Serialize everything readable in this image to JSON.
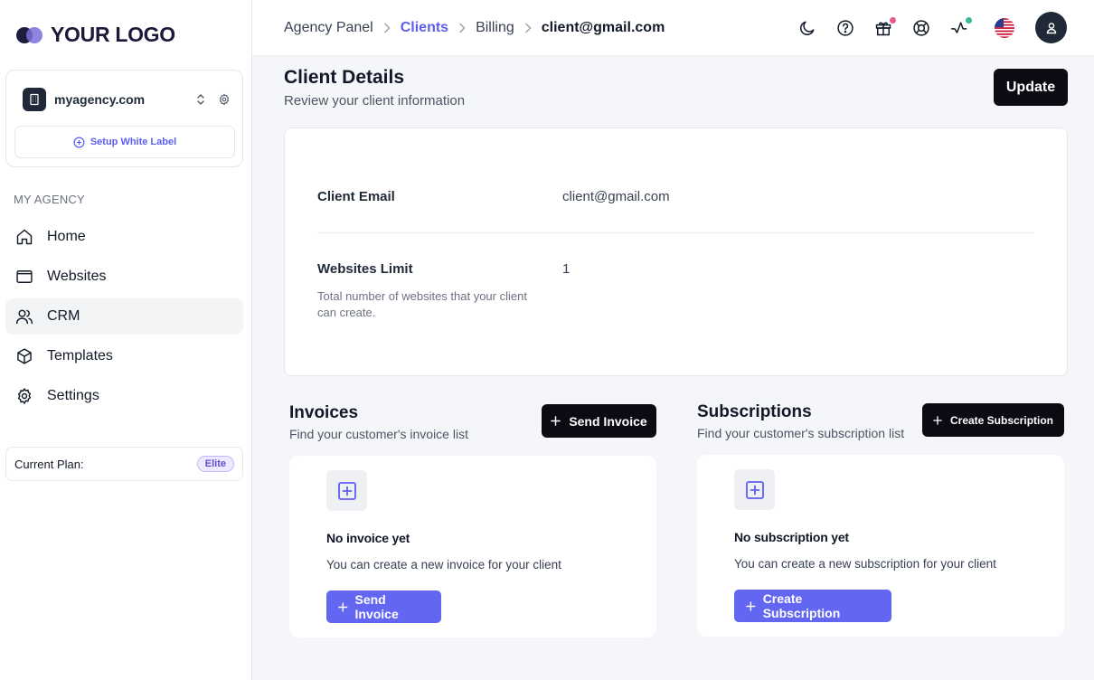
{
  "brand": {
    "logo_text": "YOUR LOGO"
  },
  "agency": {
    "name": "myagency.com",
    "setup_label": "Setup White Label"
  },
  "sidebar": {
    "section_label": "MY AGENCY",
    "items": [
      {
        "label": "Home",
        "icon": "home-icon"
      },
      {
        "label": "Websites",
        "icon": "browser-window-icon"
      },
      {
        "label": "CRM",
        "icon": "users-icon",
        "active": true
      },
      {
        "label": "Templates",
        "icon": "cube-icon"
      },
      {
        "label": "Settings",
        "icon": "gear-icon"
      }
    ],
    "plan": {
      "label": "Current Plan:",
      "badge": "Elite"
    }
  },
  "breadcrumb": [
    {
      "label": "Agency Panel",
      "style": "normal"
    },
    {
      "label": "Clients",
      "style": "link"
    },
    {
      "label": "Billing",
      "style": "normal"
    },
    {
      "label": "client@gmail.com",
      "style": "current"
    }
  ],
  "topbar": {
    "icons": [
      "moon-icon",
      "help-icon",
      "gift-icon",
      "lifebuoy-icon",
      "activity-icon",
      "us-flag-icon",
      "avatar"
    ],
    "gift_dot_color": "#e4598f",
    "activity_dot_color": "#3bb59b"
  },
  "page": {
    "title": "Client Details",
    "subtitle": "Review your client information",
    "update_label": "Update"
  },
  "details": {
    "email_label": "Client Email",
    "email_value": "client@gmail.com",
    "limit_label": "Websites Limit",
    "limit_value": "1",
    "limit_help": "Total number of websites that your client can create."
  },
  "invoices": {
    "title": "Invoices",
    "subtitle": "Find your customer's invoice list",
    "button_label": "Send Invoice",
    "empty_title": "No invoice yet",
    "empty_text": "You can create a new invoice for your client",
    "empty_button_label": "Send Invoice"
  },
  "subscriptions": {
    "title": "Subscriptions",
    "subtitle": "Find your customer's subscription list",
    "button_label": "Create Subscription",
    "empty_title": "No subscription yet",
    "empty_text": "You can create a new subscription for your client",
    "empty_button_label": "Create Subscription"
  },
  "colors": {
    "accent": "#5d5fef",
    "primary_button": "#6366f1",
    "dark_button": "#0b0b14",
    "background": "#f5f6fa"
  }
}
